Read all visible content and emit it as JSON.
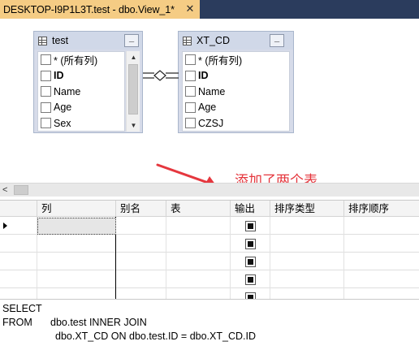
{
  "tab": {
    "title": "DESKTOP-I9P1L3T.test - dbo.View_1*",
    "close_glyph": "✕"
  },
  "tables": [
    {
      "name": "test",
      "columns": [
        "* (所有列)",
        "ID",
        "Name",
        "Age",
        "Sex"
      ],
      "bold": [
        false,
        true,
        false,
        false,
        false
      ]
    },
    {
      "name": "XT_CD",
      "columns": [
        "* (所有列)",
        "ID",
        "Name",
        "Age",
        "CZSJ"
      ],
      "bold": [
        false,
        true,
        false,
        false,
        false
      ]
    }
  ],
  "annotation": "添加了两个表",
  "grid": {
    "headers": [
      "列",
      "别名",
      "表",
      "输出",
      "排序类型",
      "排序顺序"
    ],
    "output_checked": [
      true,
      true,
      true,
      true,
      true
    ]
  },
  "sql": {
    "select": "SELECT",
    "from_kw": "FROM",
    "from_text": "dbo.test INNER JOIN",
    "join_text": "dbo.XT_CD ON dbo.test.ID = dbo.XT_CD.ID"
  },
  "colors": {
    "tab_bg": "#2b3c5d",
    "active_tab": "#f5cc84",
    "annotation": "#e5373e"
  }
}
